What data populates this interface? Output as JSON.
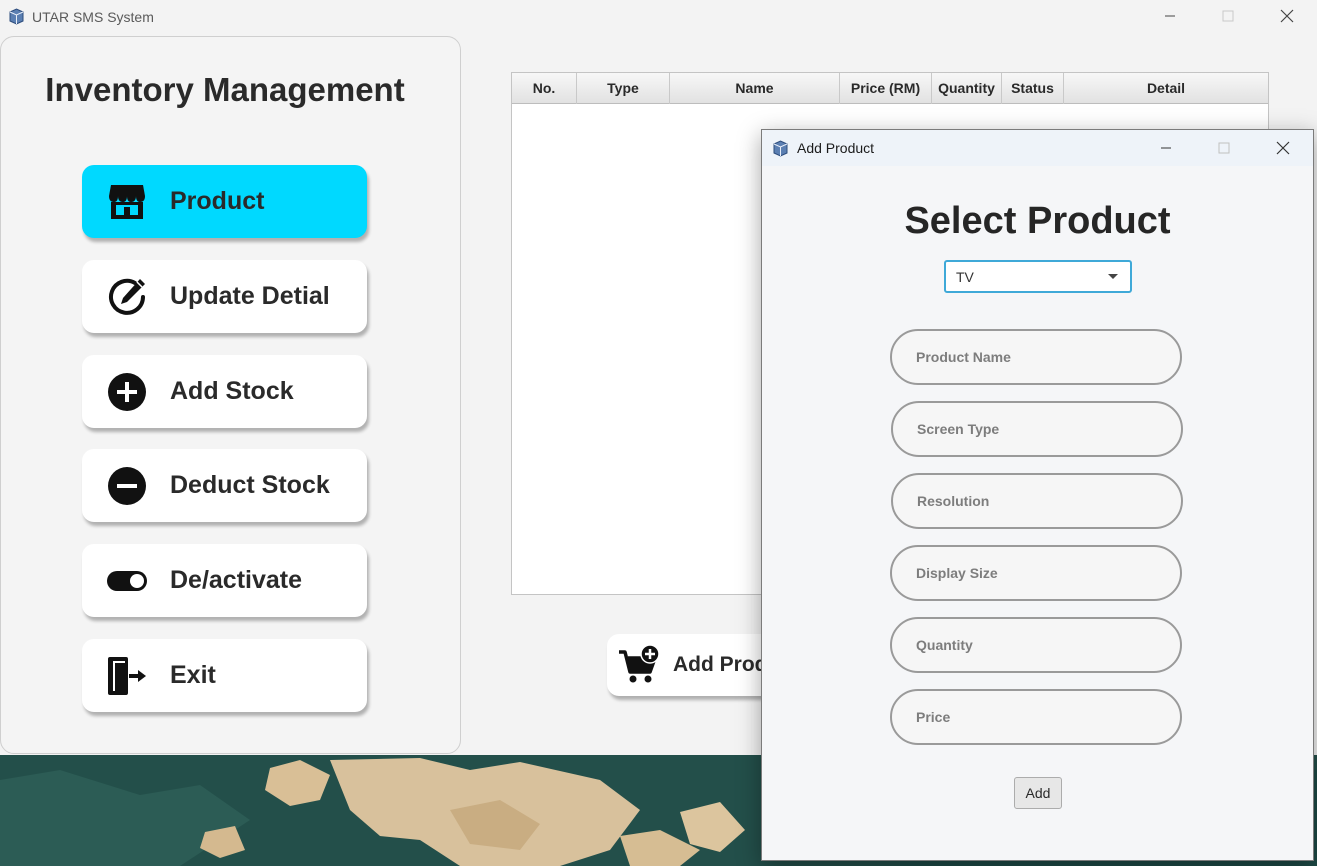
{
  "main_window": {
    "title": "UTAR SMS System",
    "controls": {
      "minimize": "minimize-icon",
      "maximize": "maximize-icon",
      "close": "close-icon"
    }
  },
  "sidebar": {
    "title": "Inventory Management",
    "items": [
      {
        "label": "Product",
        "icon": "store-icon",
        "active": true
      },
      {
        "label": "Update Detial",
        "icon": "edit-pen-icon",
        "active": false
      },
      {
        "label": "Add Stock",
        "icon": "plus-circle-icon",
        "active": false
      },
      {
        "label": "Deduct Stock",
        "icon": "minus-circle-icon",
        "active": false
      },
      {
        "label": "De/activate",
        "icon": "toggle-icon",
        "active": false
      },
      {
        "label": "Exit",
        "icon": "exit-door-icon",
        "active": false
      }
    ],
    "active_color": "#00d9ff"
  },
  "table": {
    "columns": [
      "No.",
      "Type",
      "Name",
      "Price (RM)",
      "Quantity",
      "Status",
      "Detail"
    ],
    "rows": []
  },
  "main_actions": {
    "add_product_label": "Add Product",
    "add_product_icon": "cart-plus-icon"
  },
  "dialog": {
    "title": "Add Product",
    "heading": "Select Product",
    "select": {
      "value": "TV"
    },
    "fields": [
      {
        "placeholder": "Product Name"
      },
      {
        "placeholder": "Screen Type"
      },
      {
        "placeholder": "Resolution"
      },
      {
        "placeholder": "Display Size"
      },
      {
        "placeholder": "Quantity"
      },
      {
        "placeholder": "Price"
      }
    ],
    "submit_label": "Add",
    "accent": "#3fa9d8"
  }
}
